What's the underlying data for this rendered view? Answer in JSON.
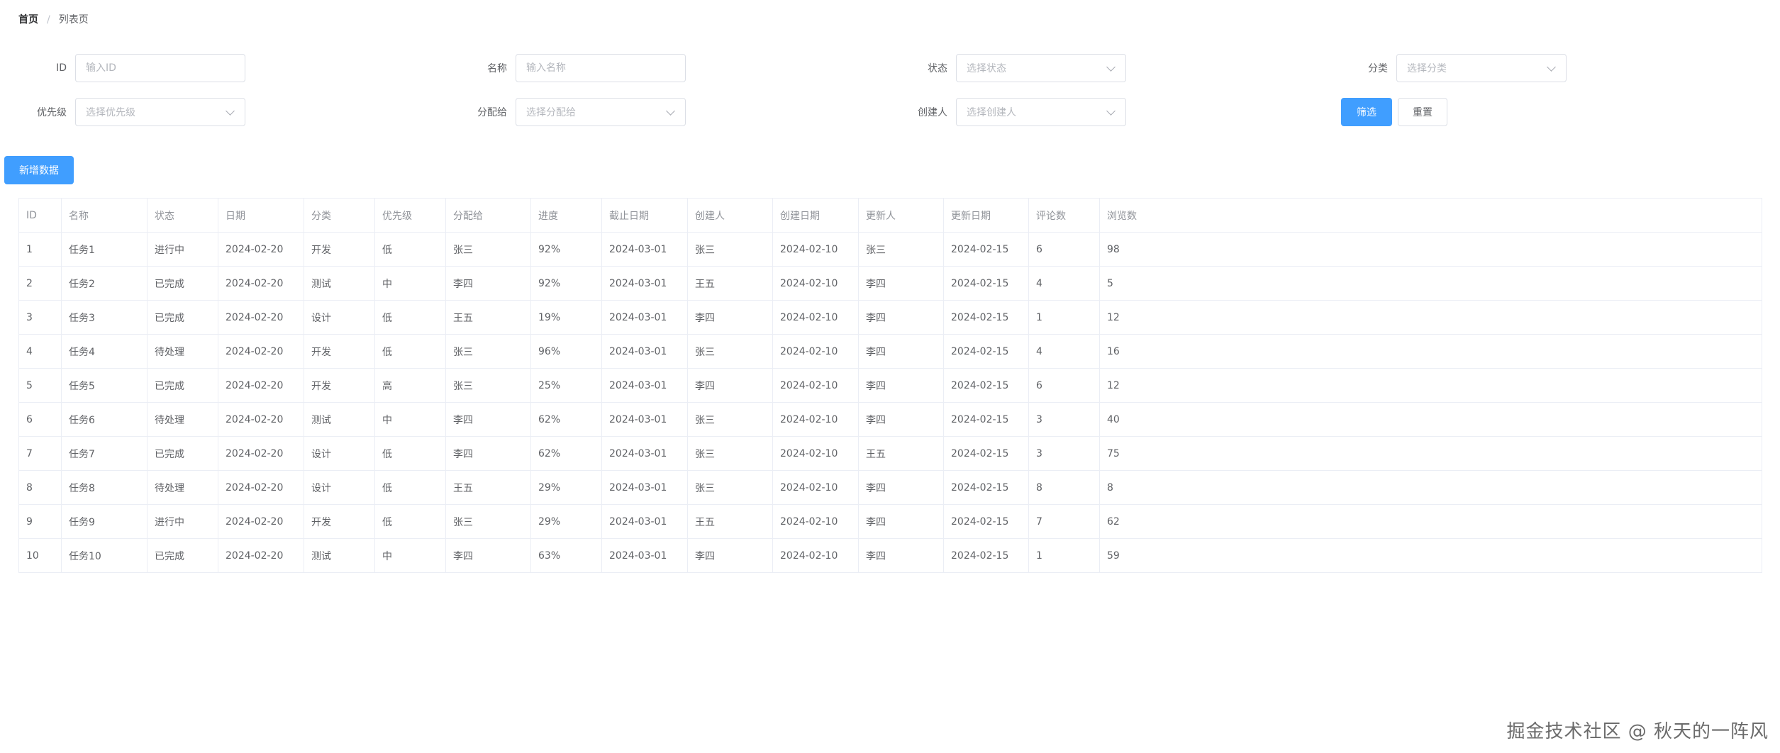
{
  "breadcrumb": {
    "home": "首页",
    "separator": "/",
    "current": "列表页"
  },
  "filters": {
    "id": {
      "label": "ID",
      "placeholder": "输入ID"
    },
    "name": {
      "label": "名称",
      "placeholder": "输入名称"
    },
    "status": {
      "label": "状态",
      "placeholder": "选择状态"
    },
    "category": {
      "label": "分类",
      "placeholder": "选择分类"
    },
    "priority": {
      "label": "优先级",
      "placeholder": "选择优先级"
    },
    "assignee": {
      "label": "分配给",
      "placeholder": "选择分配给"
    },
    "creator": {
      "label": "创建人",
      "placeholder": "选择创建人"
    }
  },
  "buttons": {
    "filter": "筛选",
    "reset": "重置",
    "add": "新增数据"
  },
  "table": {
    "columns": [
      "ID",
      "名称",
      "状态",
      "日期",
      "分类",
      "优先级",
      "分配给",
      "进度",
      "截止日期",
      "创建人",
      "创建日期",
      "更新人",
      "更新日期",
      "评论数",
      "浏览数"
    ],
    "rows": [
      [
        "1",
        "任务1",
        "进行中",
        "2024-02-20",
        "开发",
        "低",
        "张三",
        "92%",
        "2024-03-01",
        "张三",
        "2024-02-10",
        "张三",
        "2024-02-15",
        "6",
        "98"
      ],
      [
        "2",
        "任务2",
        "已完成",
        "2024-02-20",
        "测试",
        "中",
        "李四",
        "92%",
        "2024-03-01",
        "王五",
        "2024-02-10",
        "李四",
        "2024-02-15",
        "4",
        "5"
      ],
      [
        "3",
        "任务3",
        "已完成",
        "2024-02-20",
        "设计",
        "低",
        "王五",
        "19%",
        "2024-03-01",
        "李四",
        "2024-02-10",
        "李四",
        "2024-02-15",
        "1",
        "12"
      ],
      [
        "4",
        "任务4",
        "待处理",
        "2024-02-20",
        "开发",
        "低",
        "张三",
        "96%",
        "2024-03-01",
        "张三",
        "2024-02-10",
        "李四",
        "2024-02-15",
        "4",
        "16"
      ],
      [
        "5",
        "任务5",
        "已完成",
        "2024-02-20",
        "开发",
        "高",
        "张三",
        "25%",
        "2024-03-01",
        "李四",
        "2024-02-10",
        "李四",
        "2024-02-15",
        "6",
        "12"
      ],
      [
        "6",
        "任务6",
        "待处理",
        "2024-02-20",
        "测试",
        "中",
        "李四",
        "62%",
        "2024-03-01",
        "张三",
        "2024-02-10",
        "李四",
        "2024-02-15",
        "3",
        "40"
      ],
      [
        "7",
        "任务7",
        "已完成",
        "2024-02-20",
        "设计",
        "低",
        "李四",
        "62%",
        "2024-03-01",
        "张三",
        "2024-02-10",
        "王五",
        "2024-02-15",
        "3",
        "75"
      ],
      [
        "8",
        "任务8",
        "待处理",
        "2024-02-20",
        "设计",
        "低",
        "王五",
        "29%",
        "2024-03-01",
        "张三",
        "2024-02-10",
        "李四",
        "2024-02-15",
        "8",
        "8"
      ],
      [
        "9",
        "任务9",
        "进行中",
        "2024-02-20",
        "开发",
        "低",
        "张三",
        "29%",
        "2024-03-01",
        "王五",
        "2024-02-10",
        "李四",
        "2024-02-15",
        "7",
        "62"
      ],
      [
        "10",
        "任务10",
        "已完成",
        "2024-02-20",
        "测试",
        "中",
        "李四",
        "63%",
        "2024-03-01",
        "李四",
        "2024-02-10",
        "李四",
        "2024-02-15",
        "1",
        "59"
      ]
    ]
  },
  "watermark": "掘金技术社区 @ 秋天的一阵风",
  "colors": {
    "primary": "#409eff",
    "border": "#dcdfe6",
    "table_border": "#ebeef5",
    "header_text": "#909399",
    "body_text": "#606266"
  }
}
